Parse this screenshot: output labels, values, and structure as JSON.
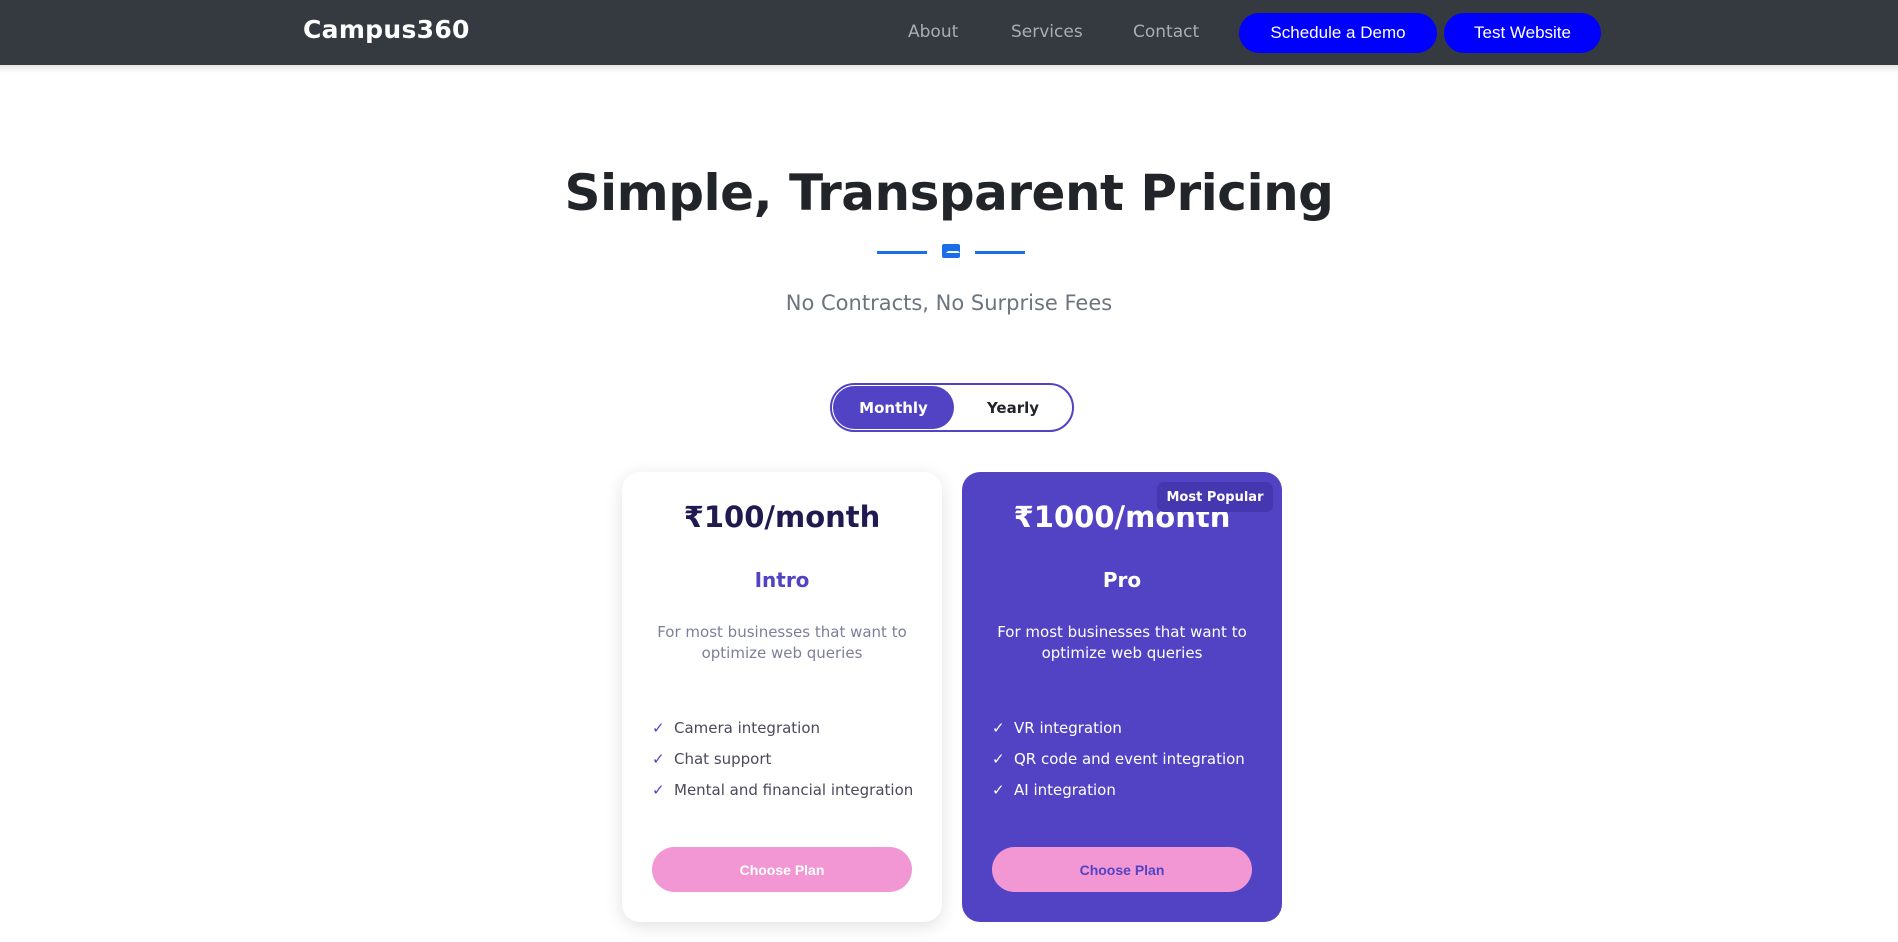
{
  "navbar": {
    "brand": "Campus360",
    "links": [
      "About",
      "Services",
      "Contact"
    ],
    "buttons": [
      "Schedule a Demo",
      "Test Website"
    ]
  },
  "hero": {
    "title": "Simple, Transparent Pricing",
    "subtitle": "No Contracts, No Surprise Fees"
  },
  "toggle": {
    "options": [
      "Monthly",
      "Yearly"
    ],
    "selected": "Monthly"
  },
  "plans": [
    {
      "price": "₹100/month",
      "name": "Intro",
      "description": "For most businesses that want to optimize web queries",
      "features": [
        "Camera integration",
        "Chat support",
        "Mental and financial integration"
      ],
      "button": "Choose Plan"
    },
    {
      "price": "₹1000/month",
      "name": "Pro",
      "badge": "Most Popular",
      "description": "For most businesses that want to optimize web queries",
      "features": [
        "VR integration",
        "QR code and event integration",
        "AI integration"
      ],
      "button": "Choose Plan"
    }
  ],
  "icons": {
    "divider": "envelope-icon",
    "feature": "check-icon"
  },
  "colors": {
    "navbar": "#343a40",
    "nav_button": "#0000ff",
    "accent": "#5143c4",
    "choose_button": "#f297d3",
    "divider": "#1a6ee8"
  }
}
